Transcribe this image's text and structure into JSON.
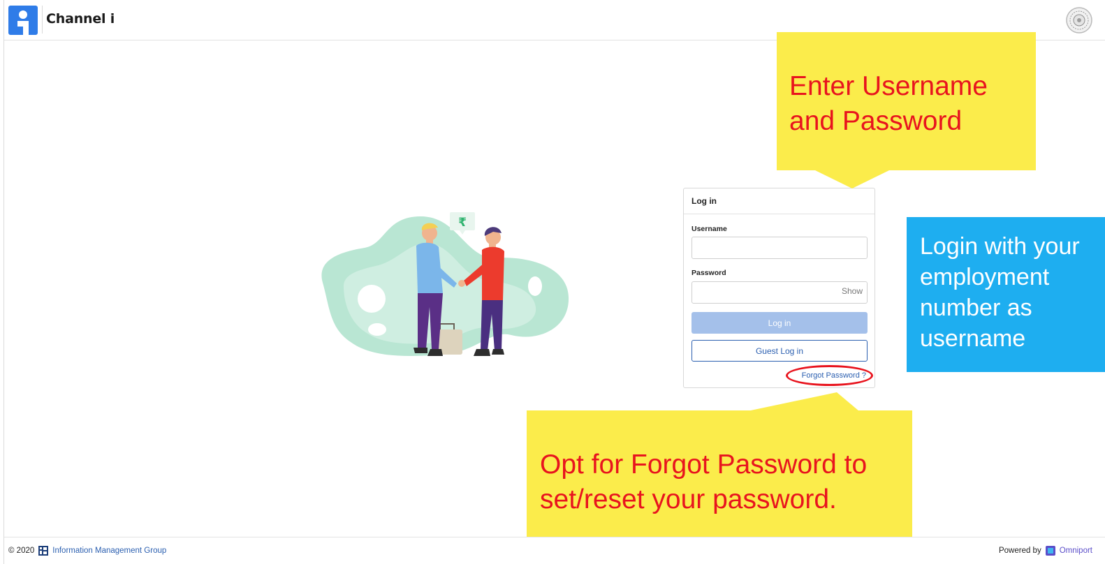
{
  "header": {
    "app_title": "Channel i",
    "logo_icon": "channel-i-logo-icon",
    "institute_logo_icon": "institute-seal-icon"
  },
  "login": {
    "title": "Log in",
    "username_label": "Username",
    "username_value": "",
    "password_label": "Password",
    "password_value": "",
    "show_label": "Show",
    "login_label": "Log in",
    "guest_label": "Guest Log in",
    "forgot_label": "Forgot Password ?"
  },
  "annotations": {
    "top": "Enter Username and Password",
    "right": "Login with your employment number as username",
    "bottom": "Opt for Forgot Password to set/reset your password."
  },
  "footer": {
    "copyright": "© 2020",
    "org_name": "Information Management Group",
    "powered_by": "Powered by",
    "brand": "Omniport"
  },
  "colors": {
    "accent_blue": "#2b5fb0",
    "login_button_disabled": "#a4c0ea",
    "callout_yellow": "#fbec4b",
    "callout_red_text": "#e8141e",
    "callout_blue": "#1eaef0"
  },
  "illustration": {
    "currency_symbol": "₹"
  }
}
